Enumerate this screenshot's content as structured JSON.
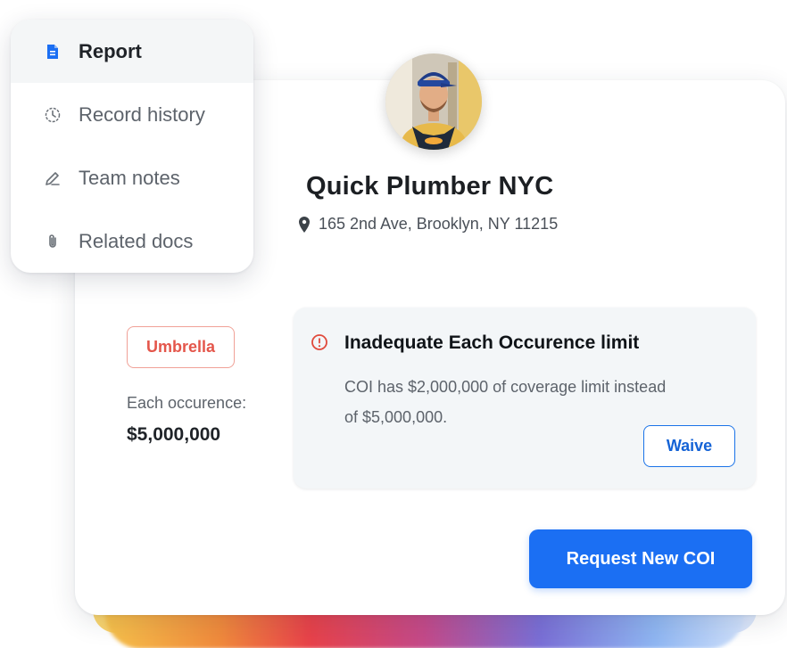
{
  "menu": {
    "items": [
      {
        "label": "Report",
        "icon": "report-doc-icon",
        "active": true
      },
      {
        "label": "Record history",
        "icon": "history-clock-icon",
        "active": false
      },
      {
        "label": "Team notes",
        "icon": "pencil-icon",
        "active": false
      },
      {
        "label": "Related docs",
        "icon": "paperclip-icon",
        "active": false
      }
    ]
  },
  "vendor": {
    "name": "Quick Plumber NYC",
    "address": "165 2nd Ave, Brooklyn, NY 11215",
    "avatar": "plumber-photo"
  },
  "policy": {
    "badge": "Umbrella",
    "each_label": "Each occurence:",
    "each_value": "$5,000,000"
  },
  "alert": {
    "title": "Inadequate Each Occurence limit",
    "body": "COI has $2,000,000 of coverage limit instead of $5,000,000.",
    "waive_label": "Waive"
  },
  "cta_label": "Request New COI",
  "colors": {
    "primary": "#1b6ff3",
    "badge": "#e4564b",
    "alert_icon": "#e04a3c"
  }
}
